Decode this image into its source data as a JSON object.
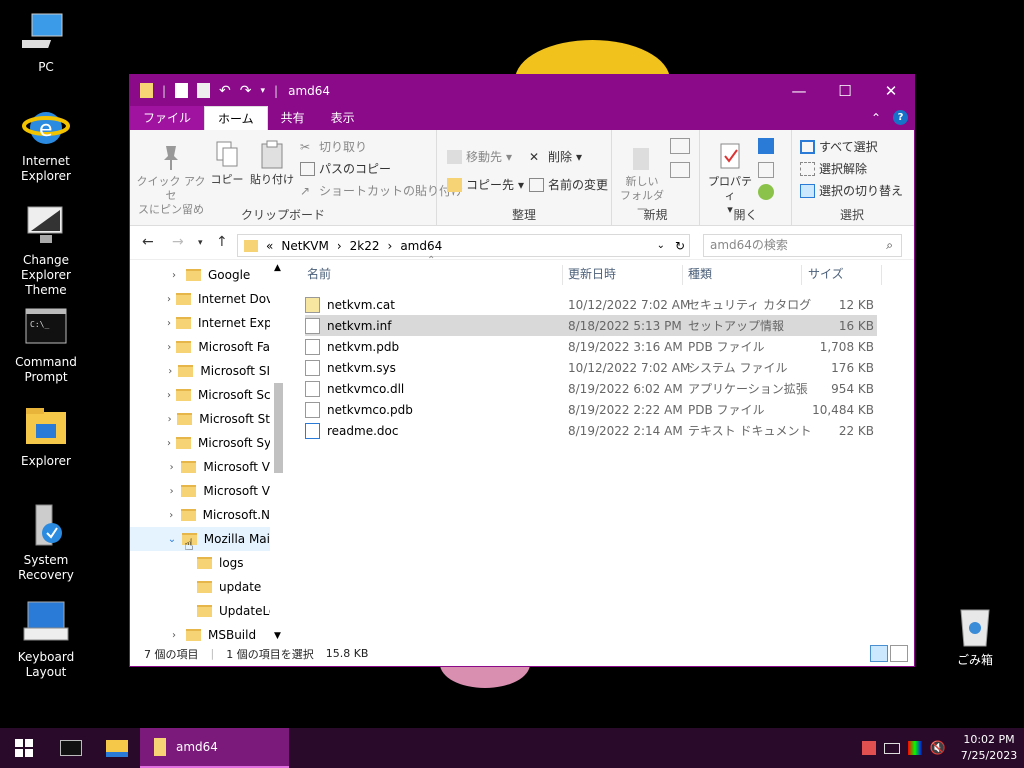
{
  "desktop": {
    "icons": [
      {
        "label": "PC"
      },
      {
        "label": "Internet Explorer"
      },
      {
        "label": "Change Explorer Theme"
      },
      {
        "label": "Command Prompt"
      },
      {
        "label": "Explorer"
      },
      {
        "label": "System Recovery"
      },
      {
        "label": "Keyboard Layout"
      }
    ],
    "recycle_bin": "ごみ箱"
  },
  "window": {
    "title": "amd64",
    "accent": "#8a0a8a",
    "menu": {
      "file": "ファイル",
      "home": "ホーム",
      "share": "共有",
      "view": "表示"
    },
    "ribbon": {
      "clipboard": {
        "name": "クリップボード",
        "pin_line1": "クイック アクセ",
        "pin_line2": "スにピン留め",
        "copy": "コピー",
        "paste": "貼り付け",
        "cut": "切り取り",
        "copy_path": "パスのコピー",
        "paste_shortcut": "ショートカットの貼り付け"
      },
      "organize": {
        "name": "整理",
        "move_to": "移動先",
        "copy_to": "コピー先",
        "delete": "削除",
        "rename": "名前の変更"
      },
      "new": {
        "name": "新規",
        "new_folder_line1": "新しい",
        "new_folder_line2": "フォルダー"
      },
      "open": {
        "name": "開く",
        "properties": "プロパティ"
      },
      "select": {
        "name": "選択",
        "select_all": "すべて選択",
        "select_none": "選択解除",
        "invert": "選択の切り替え"
      }
    },
    "address": {
      "prefix": "«",
      "crumbs": [
        "NetKVM",
        "2k22",
        "amd64"
      ],
      "search_placeholder": "amd64の検索"
    },
    "nav_items": [
      {
        "label": "Google"
      },
      {
        "label": "Internet Dov"
      },
      {
        "label": "Internet Exp"
      },
      {
        "label": "Microsoft Fa"
      },
      {
        "label": "Microsoft SI"
      },
      {
        "label": "Microsoft Sc"
      },
      {
        "label": "Microsoft St"
      },
      {
        "label": "Microsoft Sy"
      },
      {
        "label": "Microsoft V"
      },
      {
        "label": "Microsoft V"
      },
      {
        "label": "Microsoft.N"
      },
      {
        "label": "Mozilla Mai"
      },
      {
        "label": "logs"
      },
      {
        "label": "update"
      },
      {
        "label": "UpdateLog"
      },
      {
        "label": "MSBuild"
      }
    ],
    "columns": {
      "name": "名前",
      "date": "更新日時",
      "type": "種類",
      "size": "サイズ"
    },
    "files": [
      {
        "name": "netkvm.cat",
        "date": "10/12/2022 7:02 AM",
        "type": "セキュリティ カタログ",
        "size": "12 KB"
      },
      {
        "name": "netkvm.inf",
        "date": "8/18/2022 5:13 PM",
        "type": "セットアップ情報",
        "size": "16 KB"
      },
      {
        "name": "netkvm.pdb",
        "date": "8/19/2022 3:16 AM",
        "type": "PDB ファイル",
        "size": "1,708 KB"
      },
      {
        "name": "netkvm.sys",
        "date": "10/12/2022 7:02 AM",
        "type": "システム ファイル",
        "size": "176 KB"
      },
      {
        "name": "netkvmco.dll",
        "date": "8/19/2022 6:02 AM",
        "type": "アプリケーション拡張",
        "size": "954 KB"
      },
      {
        "name": "netkvmco.pdb",
        "date": "8/19/2022 2:22 AM",
        "type": "PDB ファイル",
        "size": "10,484 KB"
      },
      {
        "name": "readme.doc",
        "date": "8/19/2022 2:14 AM",
        "type": "テキスト ドキュメント",
        "size": "22 KB"
      }
    ],
    "status": {
      "items": "7 個の項目",
      "selected": "1 個の項目を選択",
      "size": "15.8 KB"
    }
  },
  "taskbar": {
    "active_label": "amd64",
    "time": "10:02 PM",
    "date": "7/25/2023"
  }
}
